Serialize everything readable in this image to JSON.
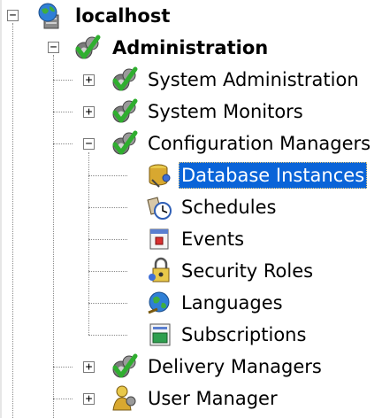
{
  "tree": {
    "root": {
      "label": "localhost",
      "expander": "−"
    },
    "administration": {
      "label": "Administration",
      "expander": "−"
    },
    "items": [
      {
        "id": "system-administration",
        "label": "System Administration",
        "expander": "+"
      },
      {
        "id": "system-monitors",
        "label": "System Monitors",
        "expander": "+"
      },
      {
        "id": "configuration-managers",
        "label": "Configuration Managers",
        "expander": "−"
      },
      {
        "id": "database-instances",
        "label": "Database Instances",
        "selected": true
      },
      {
        "id": "schedules",
        "label": "Schedules"
      },
      {
        "id": "events",
        "label": "Events"
      },
      {
        "id": "security-roles",
        "label": "Security Roles"
      },
      {
        "id": "languages",
        "label": "Languages"
      },
      {
        "id": "subscriptions",
        "label": "Subscriptions"
      },
      {
        "id": "delivery-managers",
        "label": "Delivery Managers",
        "expander": "+"
      },
      {
        "id": "user-manager",
        "label": "User Manager",
        "expander": "+"
      }
    ]
  },
  "icons": {
    "root": "globe-server-icon",
    "group": "green-check-gear-icon",
    "database-instances": "database-key-icon",
    "schedules": "schedule-clock-icon",
    "events": "event-calendar-icon",
    "security-roles": "security-key-icon",
    "languages": "globe-language-icon",
    "subscriptions": "subscription-screen-icon",
    "user-manager": "user-manager-icon"
  },
  "colors": {
    "selection": "#0a64d8",
    "check_green": "#2fae2f",
    "gear_gray": "#7b7b7b"
  }
}
